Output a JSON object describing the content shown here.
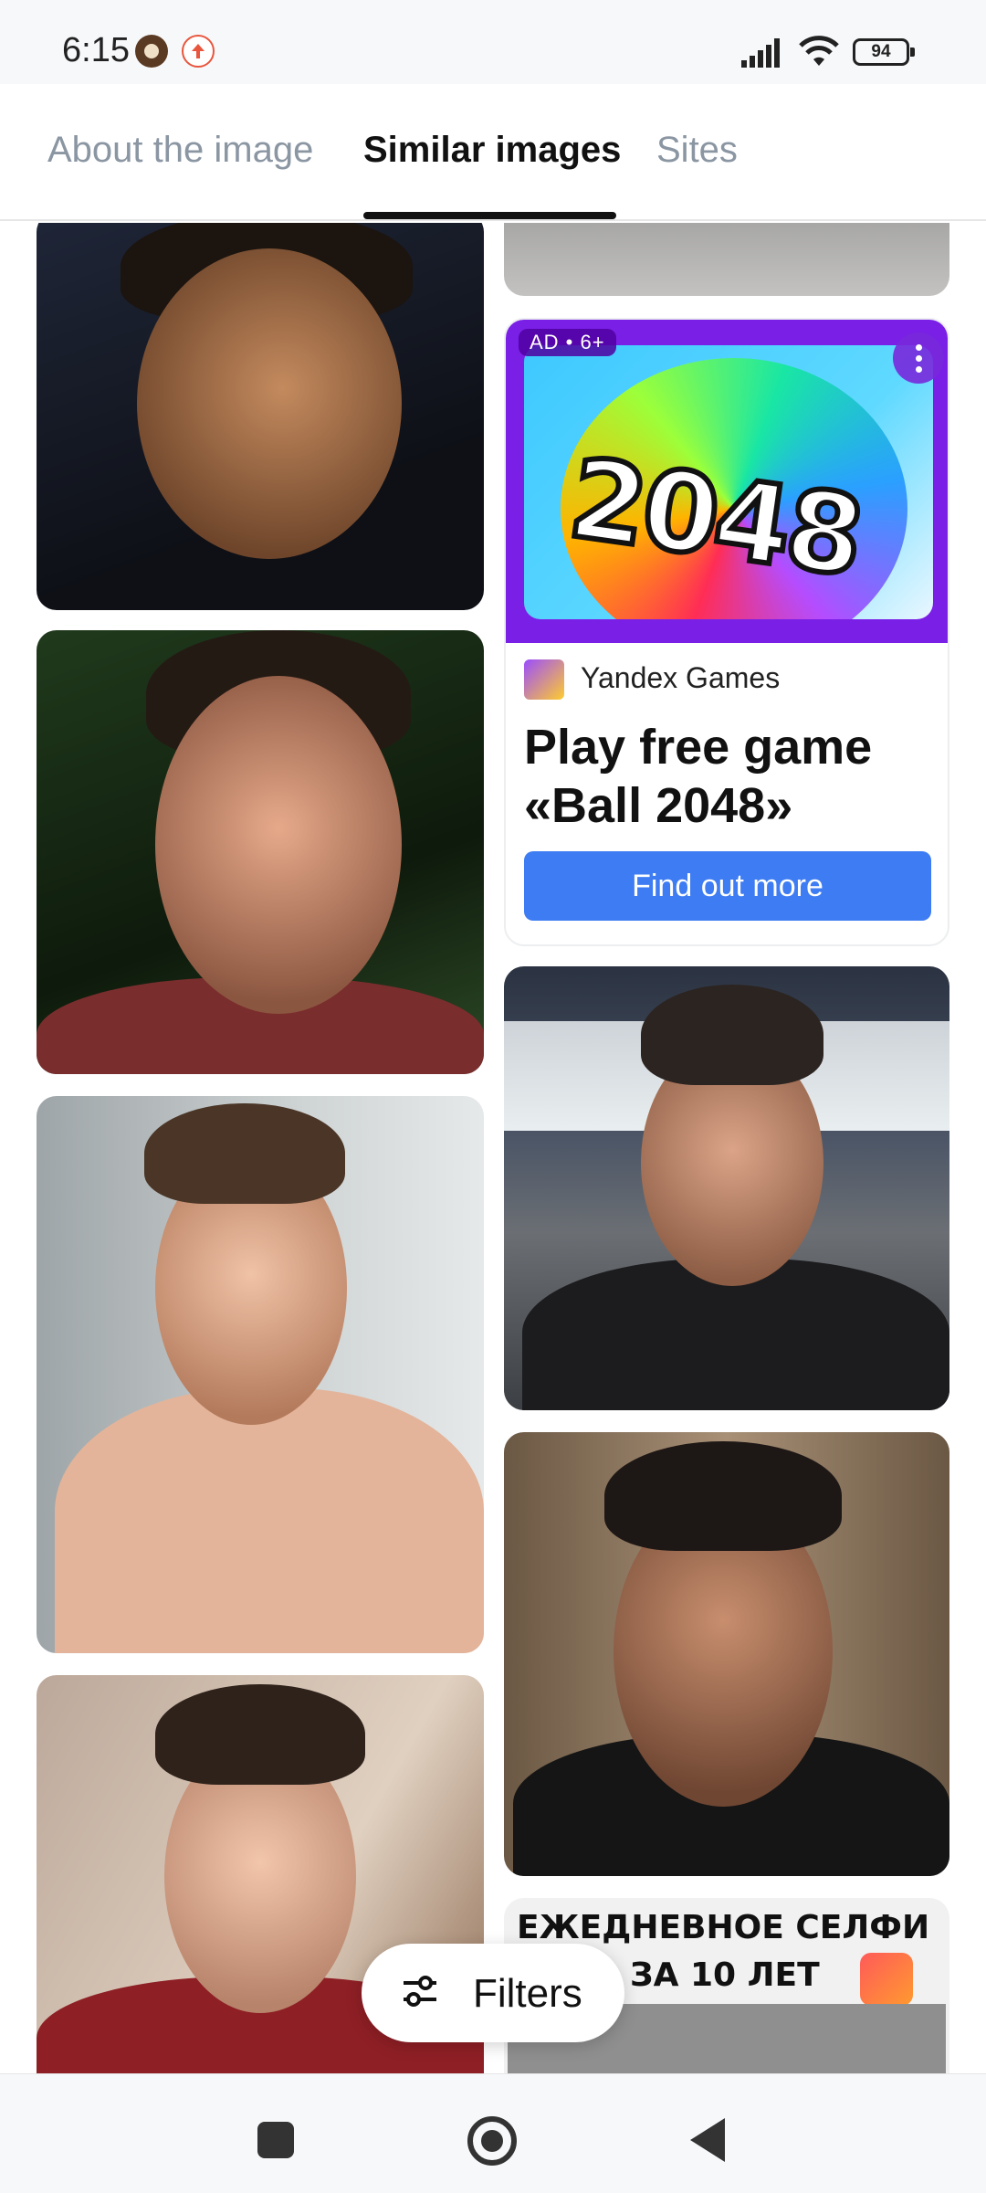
{
  "status_bar": {
    "time": "6:15",
    "battery": "94",
    "icons": [
      "lion-badge-icon",
      "upload-icon",
      "signal-icon",
      "wifi-icon",
      "battery-icon"
    ]
  },
  "tabs": [
    {
      "label": "About the image",
      "active": false
    },
    {
      "label": "Similar images",
      "active": true
    },
    {
      "label": "Sites",
      "active": false
    }
  ],
  "ad": {
    "badge": "AD • 6+",
    "game_art_text": "2048",
    "source": "Yandex Games",
    "title": "Play free game «Ball 2048»",
    "cta": "Find out more"
  },
  "selfie_tile_text": {
    "line1": "ЕЖЕДНЕВНОЕ СЕЛФИ",
    "line2": "ЗА 10 ЛЕТ"
  },
  "filters_button": {
    "label": "Filters",
    "icon": "sliders-icon"
  },
  "nav": {
    "icons": [
      "recents-icon",
      "home-icon",
      "back-icon"
    ]
  },
  "colors": {
    "accent": "#3d7cf2",
    "ad_bg": "#7a1fe6"
  }
}
